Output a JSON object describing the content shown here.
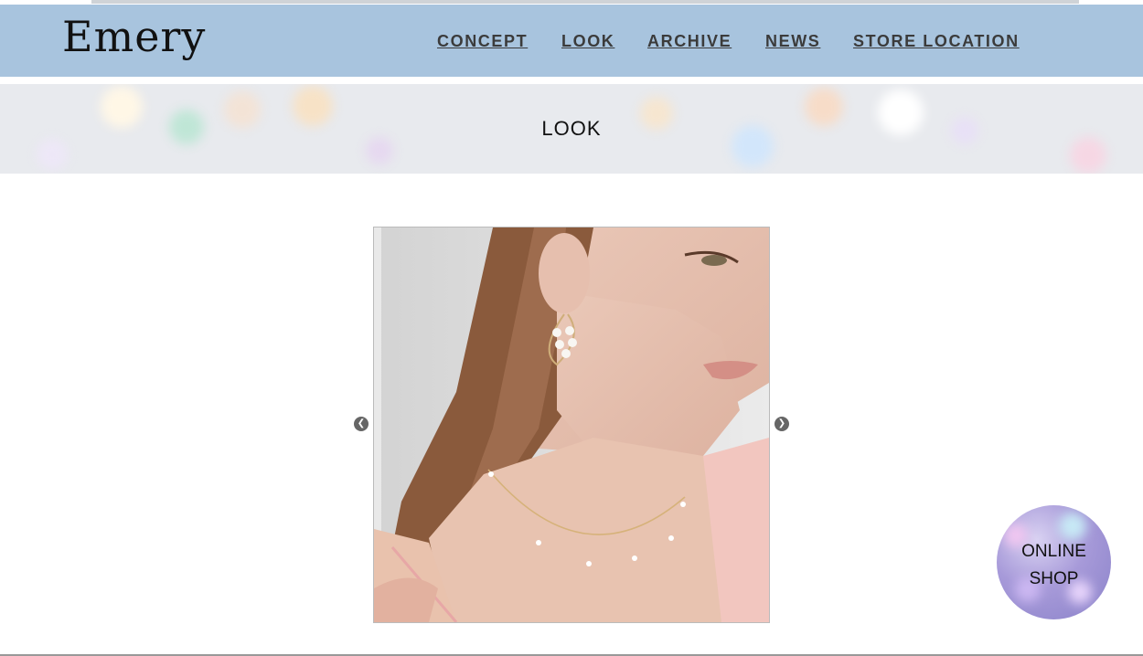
{
  "site": {
    "logo": "Emery"
  },
  "nav": {
    "items": [
      {
        "label": "CONCEPT"
      },
      {
        "label": "LOOK"
      },
      {
        "label": "ARCHIVE"
      },
      {
        "label": "NEWS"
      },
      {
        "label": "STORE LOCATION"
      }
    ]
  },
  "banner": {
    "title": "LOOK"
  },
  "slider": {
    "prev_icon": "chevron-left-circle-icon",
    "next_icon": "chevron-right-circle-icon",
    "image_alt": "Model wearing pearl hoop earring and pearl station necklace"
  },
  "online_shop": {
    "line1": "ONLINE",
    "line2": "SHOP"
  },
  "colors": {
    "header_bg": "#a8c4de",
    "nav_text": "#3b3b3b",
    "badge_purple": "#a79ad9"
  }
}
